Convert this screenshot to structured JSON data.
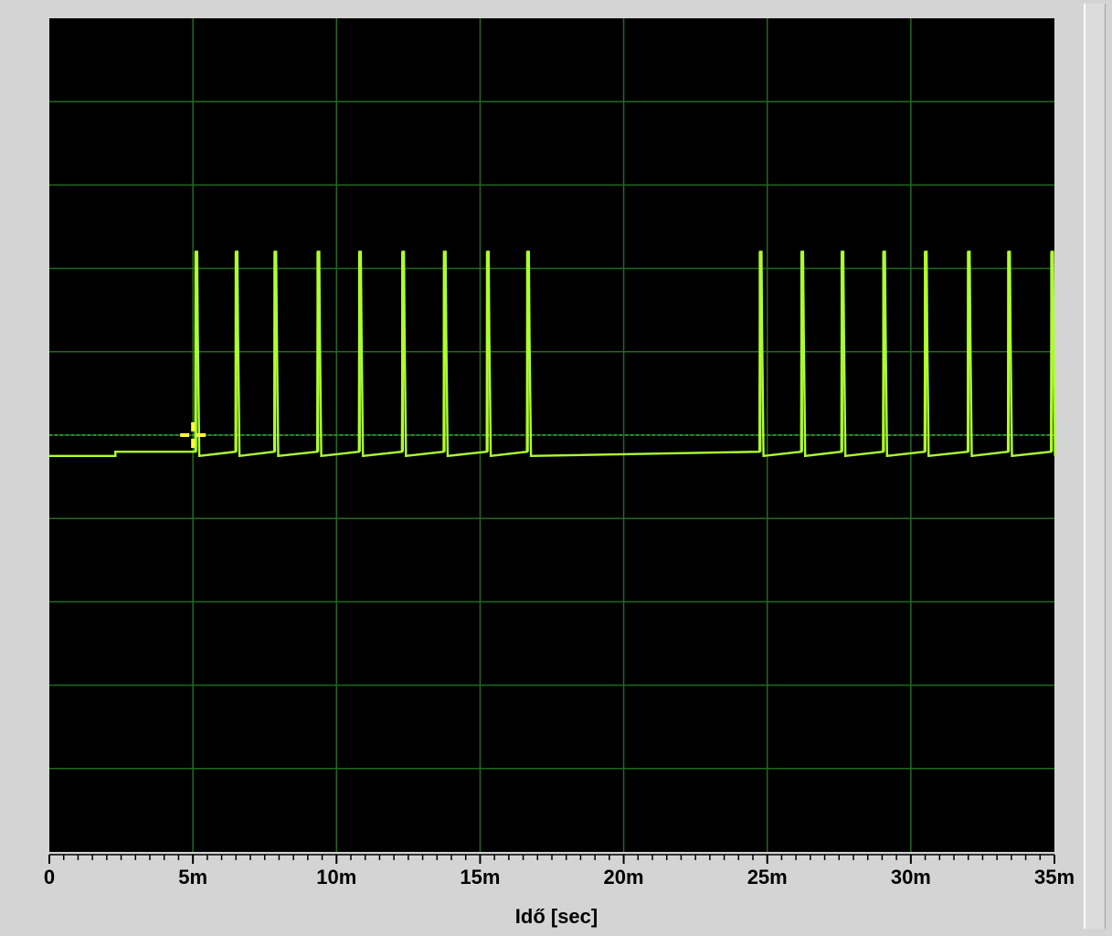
{
  "colors": {
    "background": "#d4d4d4",
    "plot_background": "#000000",
    "grid": "#1f6b1f",
    "trace": "#adff2f",
    "reference_line": "#2e8b2e",
    "cursor": "#ffff33"
  },
  "chart_data": {
    "type": "line",
    "xlabel": "Idő [sec]",
    "ylabel": "",
    "title": "",
    "xlim": [
      0,
      35
    ],
    "ylim": [
      0,
      10
    ],
    "x_unit": "ms",
    "x_ticks": [
      {
        "value": 0,
        "label": "0"
      },
      {
        "value": 5,
        "label": "5m"
      },
      {
        "value": 10,
        "label": "10m"
      },
      {
        "value": 15,
        "label": "15m"
      },
      {
        "value": 20,
        "label": "20m"
      },
      {
        "value": 25,
        "label": "25m"
      },
      {
        "value": 30,
        "label": "30m"
      },
      {
        "value": 35,
        "label": "35m"
      }
    ],
    "x_minor_tick_step": 0.5,
    "grid": true,
    "grid_x_step": 5,
    "grid_y_divisions": 10,
    "reference_level": 5.0,
    "series": [
      {
        "baseline": 4.8,
        "pulse_top": 7.2,
        "pulse_times": [
          5.1,
          6.5,
          7.85,
          9.35,
          10.8,
          12.3,
          13.75,
          15.25,
          16.65,
          24.75,
          26.2,
          27.6,
          29.05,
          30.5,
          32.0,
          33.4,
          34.9
        ],
        "pulse_width": 0.12
      }
    ],
    "cursor": {
      "x": 5.0,
      "y": 5.0
    }
  }
}
